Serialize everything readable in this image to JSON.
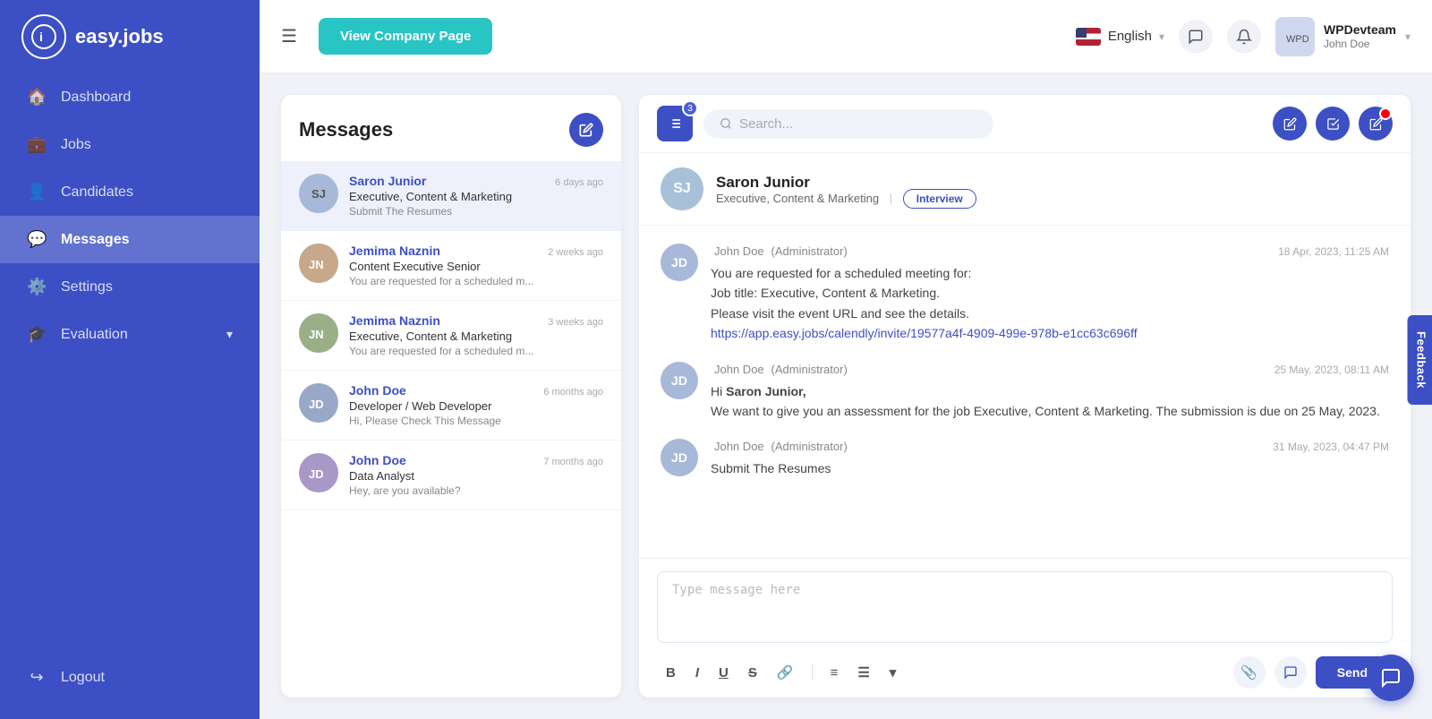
{
  "app": {
    "name": "easy.jobs",
    "logo_letter": "i"
  },
  "sidebar": {
    "items": [
      {
        "id": "dashboard",
        "label": "Dashboard",
        "icon": "🏠",
        "active": false
      },
      {
        "id": "jobs",
        "label": "Jobs",
        "icon": "💼",
        "active": false
      },
      {
        "id": "candidates",
        "label": "Candidates",
        "icon": "👤",
        "active": false
      },
      {
        "id": "messages",
        "label": "Messages",
        "icon": "💬",
        "active": true
      },
      {
        "id": "settings",
        "label": "Settings",
        "icon": "⚙️",
        "active": false
      },
      {
        "id": "evaluation",
        "label": "Evaluation",
        "icon": "🎓",
        "active": false
      }
    ],
    "logout_label": "Logout"
  },
  "topbar": {
    "menu_icon": "☰",
    "company_page_btn": "View Company Page",
    "language": "English",
    "user_company": "WPDevteam",
    "user_name": "John Doe",
    "notif_count": ""
  },
  "messages_panel": {
    "title": "Messages",
    "compose_label": "✏️",
    "items": [
      {
        "id": 1,
        "sender": "Saron Junior",
        "role": "Executive, Content & Marketing",
        "preview": "Submit The Resumes",
        "time": "6 days ago",
        "active": true,
        "initials": "SJ"
      },
      {
        "id": 2,
        "sender": "Jemima Naznin",
        "role": "Content Executive Senior",
        "preview": "You are requested for a scheduled m...",
        "time": "2 weeks ago",
        "active": false,
        "initials": "JN"
      },
      {
        "id": 3,
        "sender": "Jemima Naznin",
        "role": "Executive, Content & Marketing",
        "preview": "You are requested for a scheduled m...",
        "time": "3 weeks ago",
        "active": false,
        "initials": "JN"
      },
      {
        "id": 4,
        "sender": "John Doe",
        "role": "Developer / Web Developer",
        "preview": "Hi, Please Check This Message",
        "time": "6 months ago",
        "active": false,
        "initials": "JD"
      },
      {
        "id": 5,
        "sender": "John Doe",
        "role": "Data Analyst",
        "preview": "Hey, are you available?",
        "time": "7 months ago",
        "active": false,
        "initials": "JD"
      }
    ]
  },
  "chat": {
    "filter_count": "3",
    "search_placeholder": "Search...",
    "contact": {
      "name": "Saron Junior",
      "role": "Executive, Content & Marketing",
      "status_badge": "Interview",
      "initials": "SJ"
    },
    "messages": [
      {
        "id": 1,
        "sender": "John Doe",
        "role": "Administrator",
        "time": "18 Apr, 2023, 11:25 AM",
        "text": "You are requested for a scheduled meeting for:\nJob title: Executive, Content & Marketing.\nPlease visit the event URL and see the details.\nhttps://app.easy.jobs/calendly/invite/19577a4f-4909-499e-978b-e1cc63c696ff",
        "initials": "JD"
      },
      {
        "id": 2,
        "sender": "John Doe",
        "role": "Administrator",
        "time": "25 May, 2023, 08:11 AM",
        "text": "Hi Saron Junior,\nWe want to give you an assessment for the job Executive, Content & Marketing. The submission is due on 25 May, 2023.",
        "initials": "JD"
      },
      {
        "id": 3,
        "sender": "John Doe",
        "role": "Administrator",
        "time": "31 May, 2023, 04:47 PM",
        "text": "Submit The Resumes",
        "initials": "JD"
      }
    ],
    "input_placeholder": "Type message here",
    "send_label": "Send",
    "format_buttons": [
      "B",
      "I",
      "U",
      "S",
      "🔗",
      "≡",
      "☰"
    ],
    "recycle_icon": "♻"
  },
  "feedback_label": "Feedback"
}
